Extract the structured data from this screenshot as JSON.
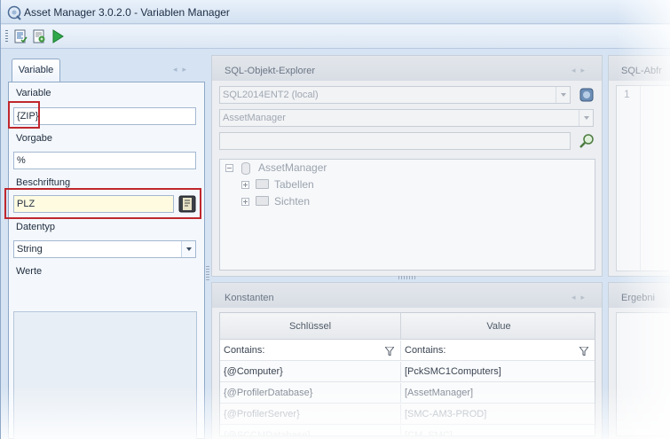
{
  "window": {
    "title": "Asset Manager 3.0.2.0 - Variablen Manager"
  },
  "toolbar": {
    "buttons": [
      "properties-icon",
      "export-icon",
      "run-icon"
    ]
  },
  "variable_panel": {
    "tab_label": "Variable",
    "variable_label": "Variable",
    "variable_value": "{ZIP}",
    "vorgabe_label": "Vorgabe",
    "vorgabe_value": "%",
    "beschriftung_label": "Beschriftung",
    "beschriftung_value": "PLZ",
    "datentyp_label": "Datentyp",
    "datentyp_value": "String",
    "werte_label": "Werte",
    "highlight_color": "#c0272d"
  },
  "sql_explorer": {
    "title": "SQL-Objekt-Explorer",
    "server_value": "SQL2014ENT2 (local)",
    "database_value": "AssetManager",
    "search_value": "",
    "tree": [
      {
        "label": "AssetManager",
        "icon": "database-icon"
      },
      {
        "label": "Tabellen",
        "icon": "folder-icon"
      },
      {
        "label": "Sichten",
        "icon": "folder-icon"
      }
    ]
  },
  "sql_editor": {
    "title": "SQL-Abfr",
    "line_number": "1"
  },
  "constants": {
    "title": "Konstanten",
    "columns": [
      "Schlüssel",
      "Value"
    ],
    "filter_label": "Contains:",
    "rows": [
      {
        "key": "{@Computer}",
        "value": "[PckSMC1Computers]"
      },
      {
        "key": "{@ProfilerDatabase}",
        "value": "[AssetManager]"
      },
      {
        "key": "{@ProfilerServer}",
        "value": "[SMC-AM3-PROD]"
      },
      {
        "key": "{@SCCMDatabase}",
        "value": "[CM_SMC]"
      }
    ]
  },
  "results": {
    "title": "Ergebni"
  }
}
